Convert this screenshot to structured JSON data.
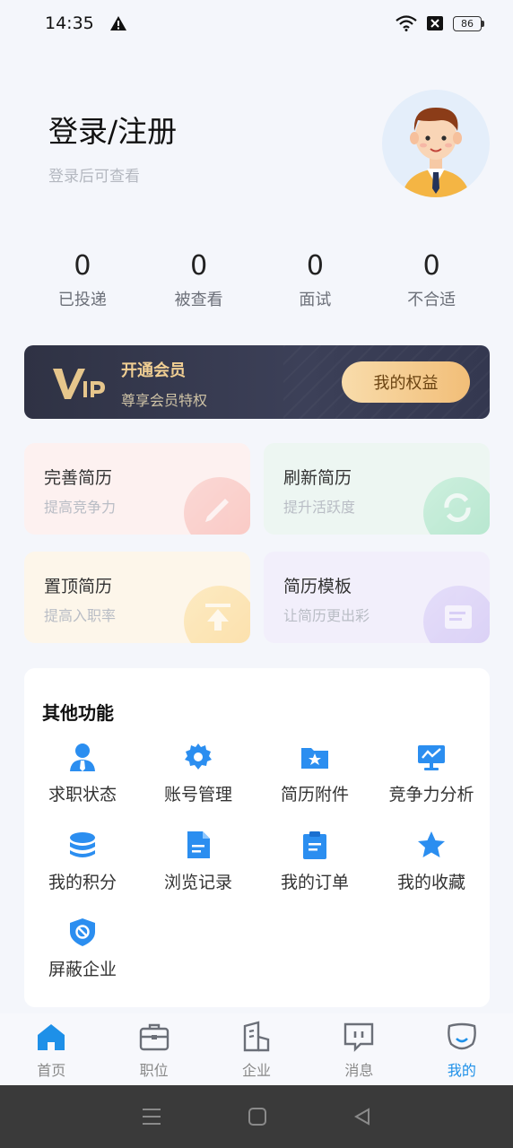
{
  "status": {
    "time": "14:35",
    "battery": "86"
  },
  "profile": {
    "title": "登录/注册",
    "subtitle": "登录后可查看"
  },
  "stats": [
    {
      "value": "0",
      "label": "已投递"
    },
    {
      "value": "0",
      "label": "被查看"
    },
    {
      "value": "0",
      "label": "面试"
    },
    {
      "value": "0",
      "label": "不合适"
    }
  ],
  "vip": {
    "title": "开通会员",
    "subtitle": "尊享会员特权",
    "button": "我的权益"
  },
  "cards": [
    {
      "title": "完善简历",
      "subtitle": "提高竞争力"
    },
    {
      "title": "刷新简历",
      "subtitle": "提升活跃度"
    },
    {
      "title": "置顶简历",
      "subtitle": "提高入职率"
    },
    {
      "title": "简历模板",
      "subtitle": "让简历更出彩"
    }
  ],
  "other": {
    "title": "其他功能",
    "items": [
      {
        "label": "求职状态",
        "icon": "user-tie-icon"
      },
      {
        "label": "账号管理",
        "icon": "gear-icon"
      },
      {
        "label": "简历附件",
        "icon": "folder-star-icon"
      },
      {
        "label": "竞争力分析",
        "icon": "monitor-chart-icon"
      },
      {
        "label": "我的积分",
        "icon": "coins-stack-icon"
      },
      {
        "label": "浏览记录",
        "icon": "document-icon"
      },
      {
        "label": "我的订单",
        "icon": "clipboard-icon"
      },
      {
        "label": "我的收藏",
        "icon": "star-icon"
      },
      {
        "label": "屏蔽企业",
        "icon": "shield-block-icon"
      }
    ]
  },
  "tabs": [
    {
      "label": "首页",
      "icon": "home-icon"
    },
    {
      "label": "职位",
      "icon": "briefcase-icon"
    },
    {
      "label": "企业",
      "icon": "building-icon"
    },
    {
      "label": "消息",
      "icon": "message-icon"
    },
    {
      "label": "我的",
      "icon": "smile-icon",
      "active": true
    }
  ],
  "colors": {
    "accent": "#1e90e8",
    "vip_gold": "#f1cf93",
    "vip_bg": "#2f3244"
  }
}
